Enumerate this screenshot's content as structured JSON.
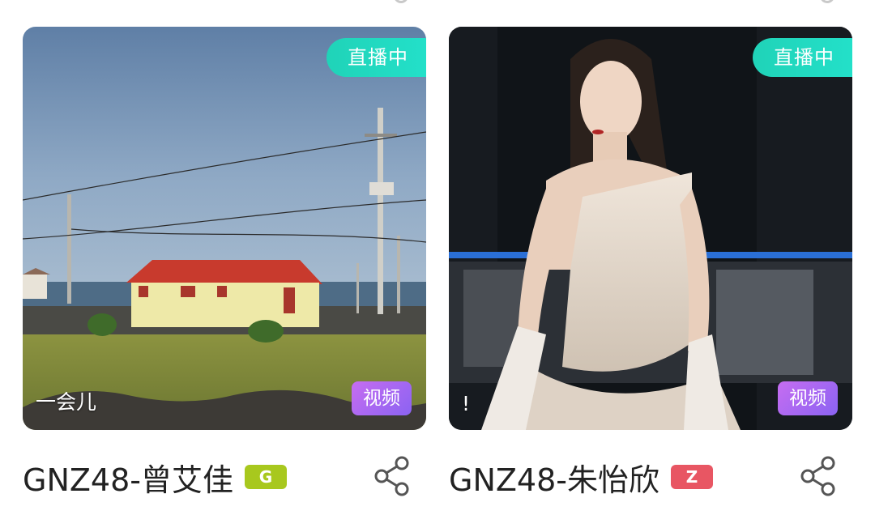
{
  "cards": [
    {
      "live_label": "直播中",
      "media_label": "视频",
      "caption": "一会儿",
      "name": "GNZ48-曾艾佳",
      "team": "G",
      "team_color": "#a8c81e",
      "share_icon": "share-icon"
    },
    {
      "live_label": "直播中",
      "media_label": "视频",
      "caption": "!",
      "name": "GNZ48-朱怡欣",
      "team": "Z",
      "team_color": "#e85663",
      "share_icon": "share-icon"
    }
  ],
  "colors": {
    "live_badge": "#20d3b8",
    "video_badge_start": "#c66df1",
    "video_badge_end": "#8b63f2",
    "name_text": "#222222"
  }
}
